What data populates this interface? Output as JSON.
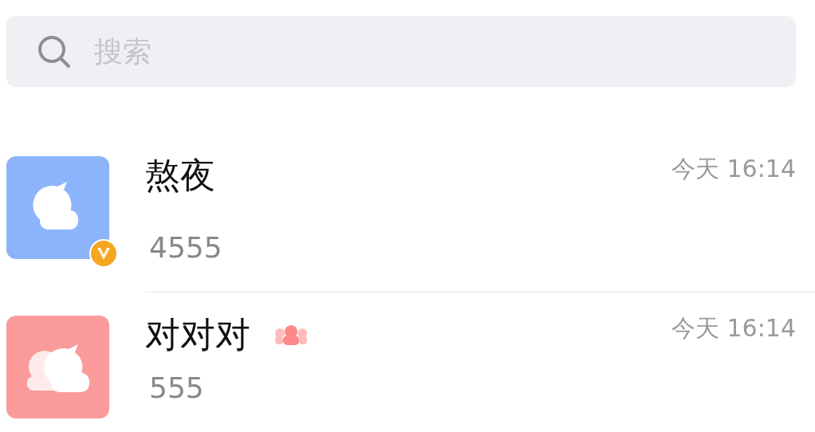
{
  "search": {
    "placeholder": "搜索"
  },
  "chats": [
    {
      "kind": "person",
      "color": "#8cb4fa",
      "verified": true,
      "name": "熬夜",
      "time": "今天 16:14",
      "message": "4555"
    },
    {
      "kind": "group",
      "color": "#fa9a9a",
      "verified": false,
      "name": "对对对",
      "time": "今天 16:14",
      "message": "555"
    }
  ]
}
